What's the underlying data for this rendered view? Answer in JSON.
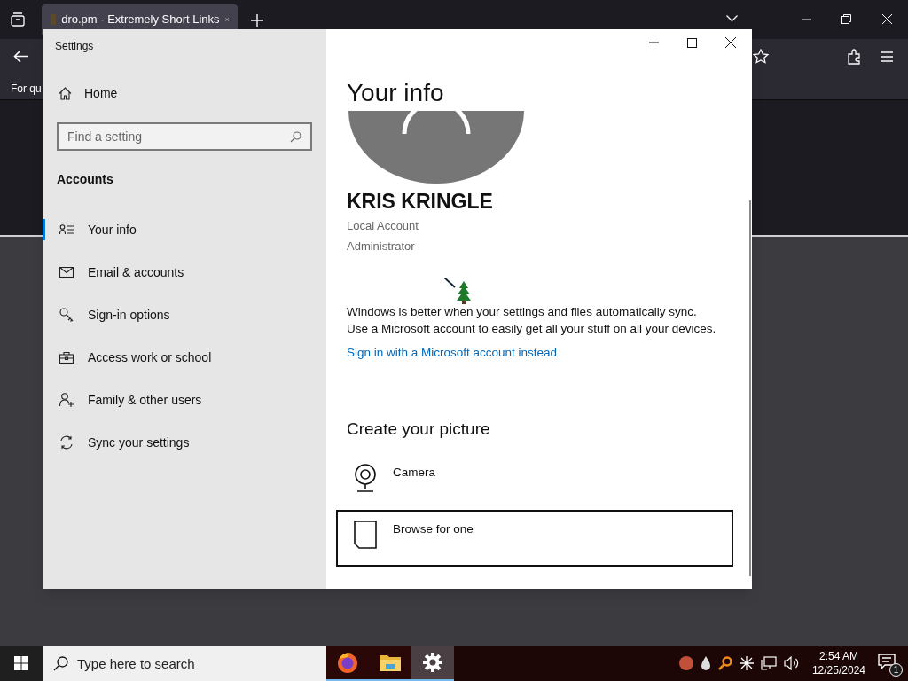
{
  "browser": {
    "tab_title": "dro.pm - Extremely Short Links",
    "bookmark_text": "For qu"
  },
  "settings": {
    "title": "Settings",
    "home": "Home",
    "search": {
      "placeholder": "Find a setting"
    },
    "section": "Accounts",
    "nav_items": [
      {
        "label": "Your info",
        "kind": "info",
        "selected": true
      },
      {
        "label": "Email & accounts",
        "kind": "mail",
        "selected": false
      },
      {
        "label": "Sign-in options",
        "kind": "key",
        "selected": false
      },
      {
        "label": "Access work or school",
        "kind": "briefcase",
        "selected": false
      },
      {
        "label": "Family & other users",
        "kind": "adduser",
        "selected": false
      },
      {
        "label": "Sync your settings",
        "kind": "sync",
        "selected": false
      }
    ],
    "heading": "Your info",
    "user_name": "KRIS KRINGLE",
    "account_type": "Local Account",
    "role": "Administrator",
    "sync_lines": [
      "Windows is better when your settings and files automatically sync.",
      "Use a Microsoft account to easily get all your stuff on all your devices."
    ],
    "link": "Sign in with a Microsoft account instead",
    "picture_heading": "Create your picture",
    "picture_options": [
      {
        "label": "Camera",
        "kind": "camera",
        "focused": false
      },
      {
        "label": "Browse for one",
        "kind": "file",
        "focused": true
      }
    ]
  },
  "taskbar": {
    "search": {
      "placeholder": "Type here to search"
    },
    "apps": [
      {
        "kind": "browser",
        "selected": false
      },
      {
        "kind": "folder",
        "selected": false
      },
      {
        "kind": "gear",
        "selected": true
      }
    ],
    "time": "2:54 AM",
    "date": "12/25/2024",
    "notifications": "1"
  }
}
